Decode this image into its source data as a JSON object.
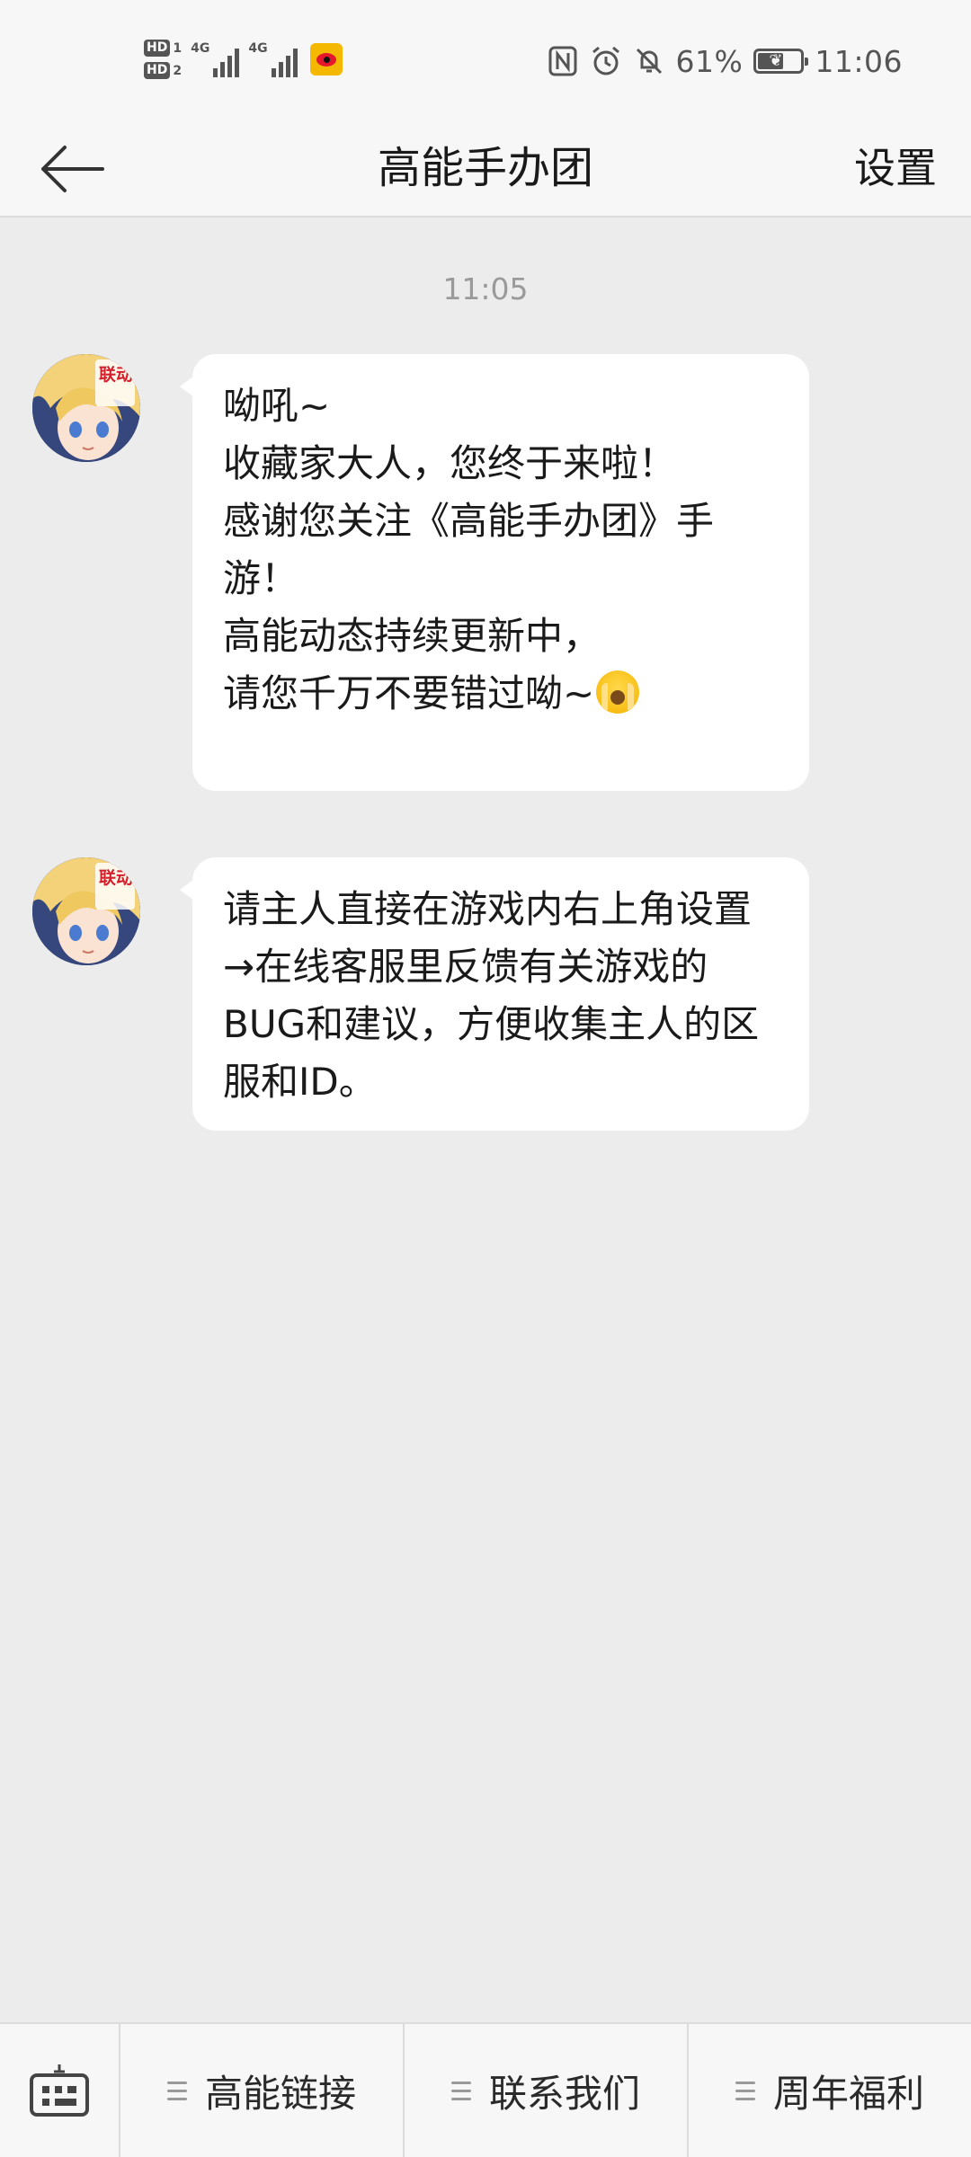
{
  "status_bar": {
    "sim1": "HD",
    "sim1_num": "1",
    "sim2": "HD",
    "sim2_num": "2",
    "net1": "4G",
    "net2": "4G",
    "battery_percent": "61%",
    "battery_level": 0.61,
    "time": "11:06",
    "icons": [
      "nfc-icon",
      "alarm-icon",
      "mute-icon",
      "weibo-icon"
    ]
  },
  "header": {
    "title": "高能手办团",
    "settings_label": "设置"
  },
  "chat": {
    "timestamp": "11:05",
    "messages": [
      {
        "text": "呦吼~\n收藏家大人，您终于来啦！\n感谢您关注《高能手办团》手游！\n高能动态持续更新中，\n请您千万不要错过呦~",
        "avatar_badge": "联动"
      },
      {
        "text": "请主人直接在游戏内右上角设置→在线客服里反馈有关游戏的BUG和建议，方便收集主人的区服和ID。",
        "avatar_badge": "联动"
      }
    ]
  },
  "bottom_menu": {
    "items": [
      {
        "label": "高能链接"
      },
      {
        "label": "联系我们"
      },
      {
        "label": "周年福利"
      }
    ]
  },
  "colors": {
    "background": "#ececec",
    "bar": "#f7f7f7",
    "bubble": "#ffffff"
  }
}
